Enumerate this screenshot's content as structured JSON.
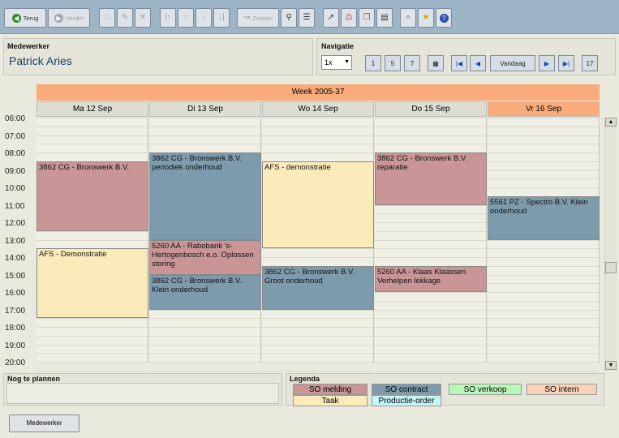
{
  "toolbar": {
    "back_label": "Terug",
    "forward_label": "Verder",
    "search_label": "Zoeken"
  },
  "employee": {
    "title": "Medewerker",
    "name": "Patrick Aries"
  },
  "navigation": {
    "title": "Navigatie",
    "zoom_value": "1x",
    "today_label": "Vandaag",
    "view_day_label": "1",
    "view_week5_label": "5",
    "view_week7_label": "7",
    "calendar_date_label": "17"
  },
  "calendar": {
    "week_label": "Week 2005-37",
    "days": [
      {
        "label": "Ma 12 Sep",
        "today": false
      },
      {
        "label": "Di 13 Sep",
        "today": false
      },
      {
        "label": "Wo 14 Sep",
        "today": false
      },
      {
        "label": "Do 15 Sep",
        "today": false
      },
      {
        "label": "Vr 16 Sep",
        "today": true
      }
    ],
    "hours": [
      "06:00",
      "07:00",
      "08:00",
      "09:00",
      "10:00",
      "11:00",
      "12:00",
      "13:00",
      "14:00",
      "15:00",
      "16:00",
      "17:00",
      "18:00",
      "19:00",
      "20:00"
    ],
    "appointments": [
      {
        "day": 0,
        "start": 8.5,
        "end": 12.5,
        "text": "3862 CG - Bronswerk B.V.",
        "type": "melding"
      },
      {
        "day": 0,
        "start": 13.5,
        "end": 17.5,
        "text": "AFS - Demonstratie",
        "type": "taak"
      },
      {
        "day": 1,
        "start": 8.0,
        "end": 13.0,
        "text": "3862 CG - Bronswerk B.V. periodiek onderhoud",
        "type": "contract"
      },
      {
        "day": 1,
        "start": 13.0,
        "end": 15.0,
        "text": "5260 AA - Rabobank 's-Hertogenbosch e.o. Oplossen storing",
        "type": "melding"
      },
      {
        "day": 1,
        "start": 15.0,
        "end": 17.0,
        "text": "3862 CG - Bronswerk B.V. Klein onderhoud",
        "type": "contract"
      },
      {
        "day": 2,
        "start": 8.5,
        "end": 13.5,
        "text": "AFS - demonstratie",
        "type": "taak"
      },
      {
        "day": 2,
        "start": 14.5,
        "end": 17.0,
        "text": "3862 CG - Bronswerk B.V. Groot onderhoud",
        "type": "contract"
      },
      {
        "day": 3,
        "start": 8.0,
        "end": 11.0,
        "text": "3862 CG - Bronswerk B.V. reparatie",
        "type": "melding"
      },
      {
        "day": 3,
        "start": 14.5,
        "end": 16.0,
        "text": "5260 AA - Klaas Klaassen Verhelpen lekkage",
        "type": "melding"
      },
      {
        "day": 4,
        "start": 10.5,
        "end": 13.0,
        "text": "5561 PZ - Spectro B.V. Klein onderhoud",
        "type": "contract"
      }
    ]
  },
  "unplanned": {
    "title": "Nog te plannen"
  },
  "legend": {
    "title": "Legenda",
    "items": [
      {
        "label": "SO melding",
        "color": "#c99596"
      },
      {
        "label": "SO contract",
        "color": "#7e9bad"
      },
      {
        "label": "SO verkoop",
        "color": "#b9f6b9"
      },
      {
        "label": "SO intern",
        "color": "#f9d3b6"
      },
      {
        "label": "Taak",
        "color": "#fbebbb"
      },
      {
        "label": "Productie-order",
        "color": "#c5f4f7"
      }
    ]
  },
  "colors": {
    "melding": "#c99596",
    "contract": "#7e9bad",
    "taak": "#fbebbb",
    "accent": "#f9ab7b"
  },
  "footer": {
    "employee_button": "Medewerker"
  }
}
